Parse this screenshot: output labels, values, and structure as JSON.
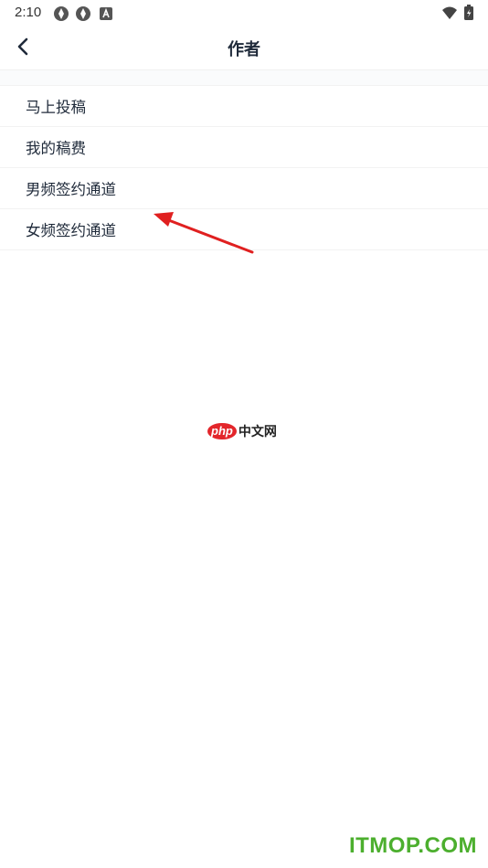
{
  "status_bar": {
    "time": "2:10",
    "icons": [
      "app-badge-icon",
      "app-badge-icon",
      "notification-a-icon",
      "wifi-icon",
      "battery-icon"
    ]
  },
  "nav": {
    "title": "作者",
    "back_icon": "chevron-left-icon"
  },
  "menu": {
    "items": [
      {
        "label": "马上投稿"
      },
      {
        "label": "我的稿费"
      },
      {
        "label": "男频签约通道"
      },
      {
        "label": "女频签约通道"
      }
    ]
  },
  "annotation": {
    "arrow_color": "#e02020"
  },
  "watermarks": {
    "center_logo": "php",
    "center_text": "中文网",
    "corner_text": "ITMOP.COM",
    "corner_color": "#4caf2e"
  }
}
